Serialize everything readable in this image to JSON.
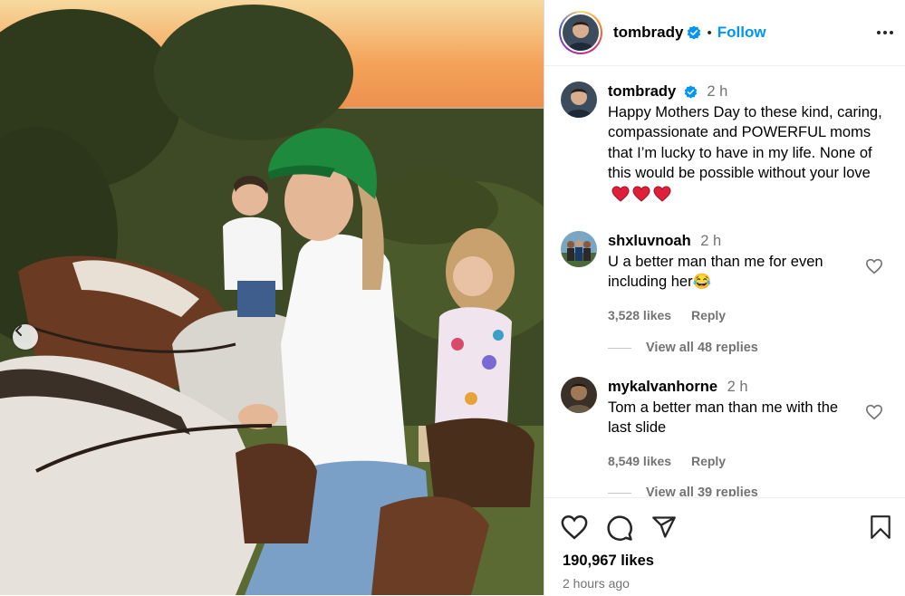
{
  "post": {
    "author": "tombrady",
    "follow_label": "Follow",
    "dot": "•",
    "caption": {
      "username": "tombrady",
      "time": "2 h",
      "text": "Happy Mothers Day to these kind, caring, compassionate and POWERFUL moms that I’m lucky to have in my life. None of this would be possible without your love"
    },
    "comments": [
      {
        "username": "shxluvnoah",
        "time": "2 h",
        "text": "U a better man than me for even including her😂",
        "likes": "3,528 likes",
        "reply": "Reply",
        "view_replies": "View all 48 replies"
      },
      {
        "username": "mykalvanhorne",
        "time": "2 h",
        "text": "Tom a better man than me with the last slide",
        "likes": "8,549 likes",
        "reply": "Reply",
        "view_replies": "View all 39 replies"
      }
    ],
    "like_count": "190,967 likes",
    "posted_ago": "2 hours ago"
  },
  "colors": {
    "follow": "#0095f6",
    "verified": "#0095f6",
    "heart_emoji": "#e0203a",
    "muted": "#737373"
  },
  "icons": [
    "verified-icon",
    "more-options-icon",
    "heart-icon",
    "comment-icon",
    "share-icon",
    "bookmark-icon",
    "chevron-left-icon"
  ]
}
